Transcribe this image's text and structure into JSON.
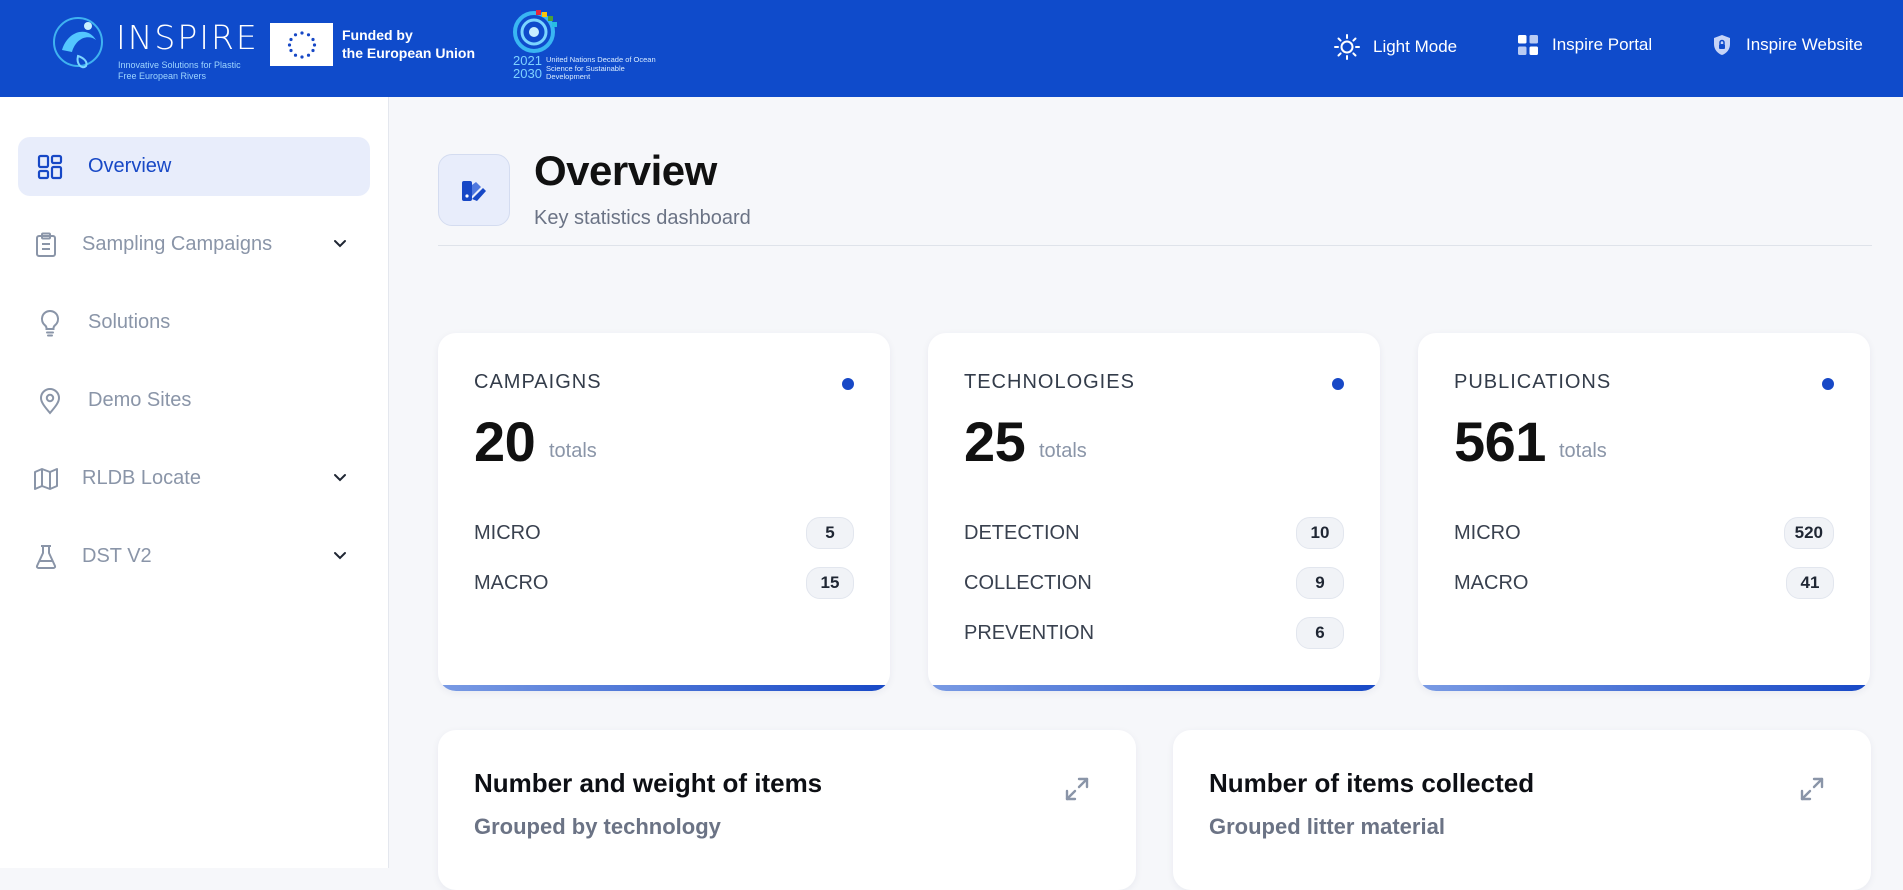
{
  "header": {
    "logo_word": "INSPIRE",
    "logo_tagline": "Innovative Solutions for Plastic Free European Rivers",
    "eu_line1": "Funded by",
    "eu_line2": "the European Union",
    "un_years_start": "2021",
    "un_years_end": "2030",
    "un_text": "United Nations Decade of Ocean Science for Sustainable Development",
    "links": [
      {
        "label": "Light Mode",
        "icon": "sun-icon"
      },
      {
        "label": "Inspire Portal",
        "icon": "grid-icon"
      },
      {
        "label": "Inspire Website",
        "icon": "shield-icon"
      }
    ]
  },
  "sidebar": {
    "items": [
      {
        "label": "Overview",
        "icon": "dashboard-icon",
        "active": true
      },
      {
        "label": "Sampling Campaigns",
        "icon": "clipboard-icon",
        "expandable": true
      },
      {
        "label": "Solutions",
        "icon": "lightbulb-icon"
      },
      {
        "label": "Demo Sites",
        "icon": "location-pin-icon"
      },
      {
        "label": "RLDB Locate",
        "icon": "map-icon",
        "expandable": true
      },
      {
        "label": "DST V2",
        "icon": "flask-icon",
        "expandable": true
      }
    ]
  },
  "page": {
    "title": "Overview",
    "subtitle": "Key statistics dashboard"
  },
  "cards": [
    {
      "label": "CAMPAIGNS",
      "total": "20",
      "totals_label": "totals",
      "rows": [
        {
          "name": "MICRO",
          "value": "5"
        },
        {
          "name": "MACRO",
          "value": "15"
        }
      ]
    },
    {
      "label": "TECHNOLOGIES",
      "total": "25",
      "totals_label": "totals",
      "rows": [
        {
          "name": "DETECTION",
          "value": "10"
        },
        {
          "name": "COLLECTION",
          "value": "9"
        },
        {
          "name": "PREVENTION",
          "value": "6"
        }
      ]
    },
    {
      "label": "PUBLICATIONS",
      "total": "561",
      "totals_label": "totals",
      "rows": [
        {
          "name": "MICRO",
          "value": "520"
        },
        {
          "name": "MACRO",
          "value": "41"
        }
      ]
    }
  ],
  "charts": [
    {
      "title": "Number and weight of items",
      "subtitle": "Grouped by technology"
    },
    {
      "title": "Number of items collected",
      "subtitle": "Grouped litter material"
    }
  ],
  "colors": {
    "header_bg": "#0f4bcb",
    "accent": "#1748c6",
    "active_bg": "#e8edfb"
  }
}
